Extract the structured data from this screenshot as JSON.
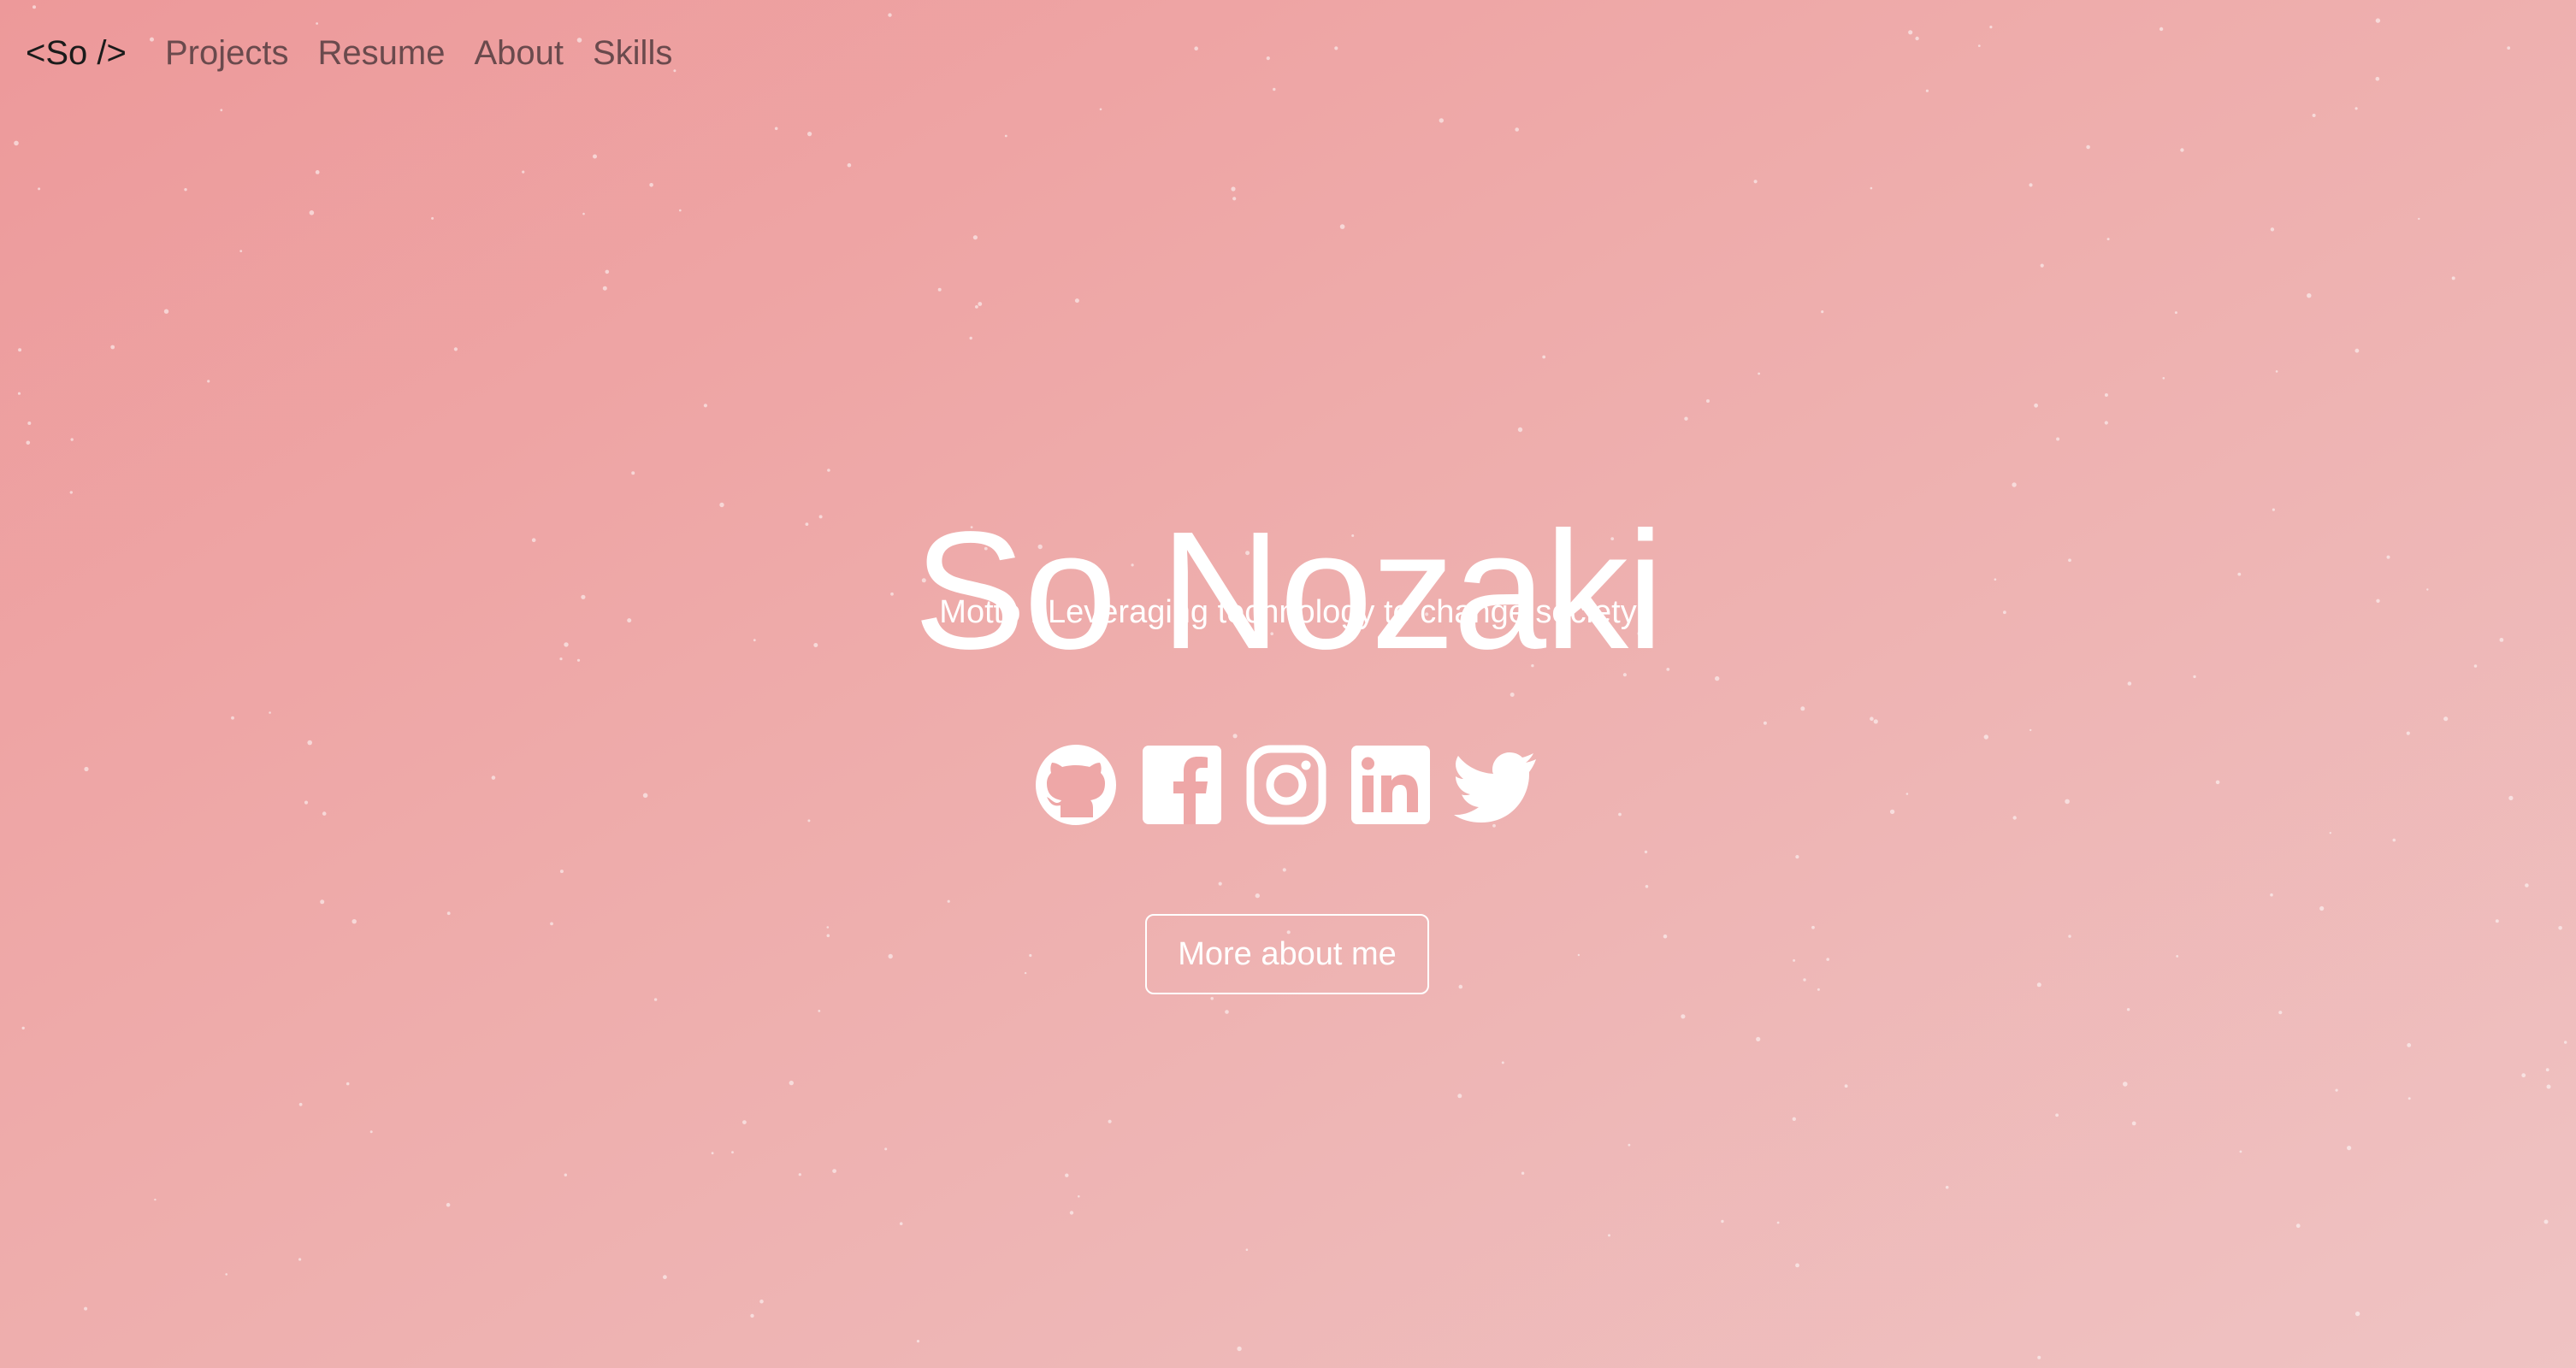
{
  "nav": {
    "brand": "<So />",
    "links": [
      "Projects",
      "Resume",
      "About",
      "Skills"
    ]
  },
  "hero": {
    "name": "So Nozaki",
    "motto": "Motto : Leveraging technology to change society",
    "button_label": "More about me"
  },
  "socials": [
    {
      "name": "github-icon"
    },
    {
      "name": "facebook-icon"
    },
    {
      "name": "instagram-icon"
    },
    {
      "name": "linkedin-icon"
    },
    {
      "name": "twitter-icon"
    }
  ],
  "colors": {
    "background_start": "#ed999a",
    "background_end": "#efc3c3",
    "hero_text": "#ffffff",
    "nav_text": "#6a4a4d",
    "brand_text": "#1b1b1b"
  }
}
